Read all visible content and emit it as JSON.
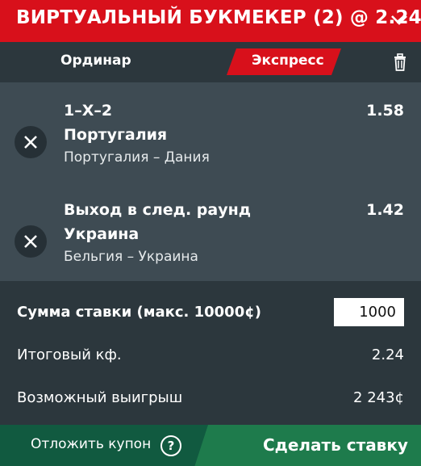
{
  "header": {
    "title": "ВИРТУАЛЬНЫЙ БУКМЕКЕР (2) @ 2.24",
    "chevron_icon": "chevron-down-icon"
  },
  "tabs": {
    "single": "Ординар",
    "express": "Экспресс",
    "trash_icon": "trash-icon"
  },
  "bets": [
    {
      "market": "1–Х–2",
      "selection": "Португалия",
      "event": "Португалия – Дания",
      "odds": "1.58",
      "remove_icon": "close-icon"
    },
    {
      "market": "Выход в след. раунд",
      "selection": "Украина",
      "event": "Бельгия – Украина",
      "odds": "1.42",
      "remove_icon": "close-icon"
    }
  ],
  "summary": {
    "stake_label": "Сумма ставки (макс. 10000¢)",
    "stake_value": "1000",
    "total_odds_label": "Итоговый кф.",
    "total_odds_value": "2.24",
    "payout_label": "Возможный выигрыш",
    "payout_value": "2 243¢"
  },
  "footer": {
    "postpone": "Отложить купон",
    "help": "?",
    "place_bet": "Сделать ставку"
  },
  "colors": {
    "header": "#d8101b",
    "accent_red": "#d8101b",
    "dark": "#2c373d",
    "panel": "#3e4b53",
    "green_dark": "#115a40",
    "green": "#1e7b4c"
  }
}
